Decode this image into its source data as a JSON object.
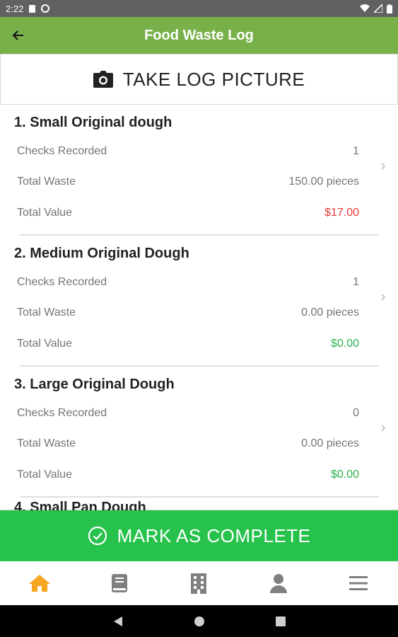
{
  "status_bar": {
    "time": "2:22"
  },
  "app_bar": {
    "title": "Food Waste Log"
  },
  "take_picture": {
    "label": "TAKE LOG PICTURE",
    "icon": "camera-icon"
  },
  "colors": {
    "app_bar": "#78b14a",
    "complete": "#27c24c",
    "value_red": "#e53935",
    "value_green": "#2bb24c",
    "nav_active": "#f5a623",
    "nav_inactive": "#808080"
  },
  "items": [
    {
      "title": "1. Small Original dough",
      "rows": [
        {
          "label": "Checks Recorded",
          "value": "1"
        },
        {
          "label": "Total Waste",
          "value": "150.00 pieces"
        },
        {
          "label": "Total Value",
          "value": "$17.00",
          "tone": "red"
        }
      ]
    },
    {
      "title": "2. Medium Original Dough",
      "rows": [
        {
          "label": "Checks Recorded",
          "value": "1"
        },
        {
          "label": "Total Waste",
          "value": "0.00 pieces"
        },
        {
          "label": "Total Value",
          "value": "$0.00",
          "tone": "green"
        }
      ]
    },
    {
      "title": "3. Large Original Dough",
      "rows": [
        {
          "label": "Checks Recorded",
          "value": "0"
        },
        {
          "label": "Total Waste",
          "value": "0.00 pieces"
        },
        {
          "label": "Total Value",
          "value": "$0.00",
          "tone": "green"
        }
      ]
    }
  ],
  "next_item_peek": "4. Small Pan Dough",
  "complete_button": {
    "label": "MARK AS COMPLETE",
    "icon": "check-circle-icon"
  },
  "bottom_nav": [
    {
      "icon": "home-icon",
      "active": true
    },
    {
      "icon": "book-icon",
      "active": false
    },
    {
      "icon": "building-icon",
      "active": false
    },
    {
      "icon": "person-icon",
      "active": false
    },
    {
      "icon": "menu-icon",
      "active": false
    }
  ]
}
